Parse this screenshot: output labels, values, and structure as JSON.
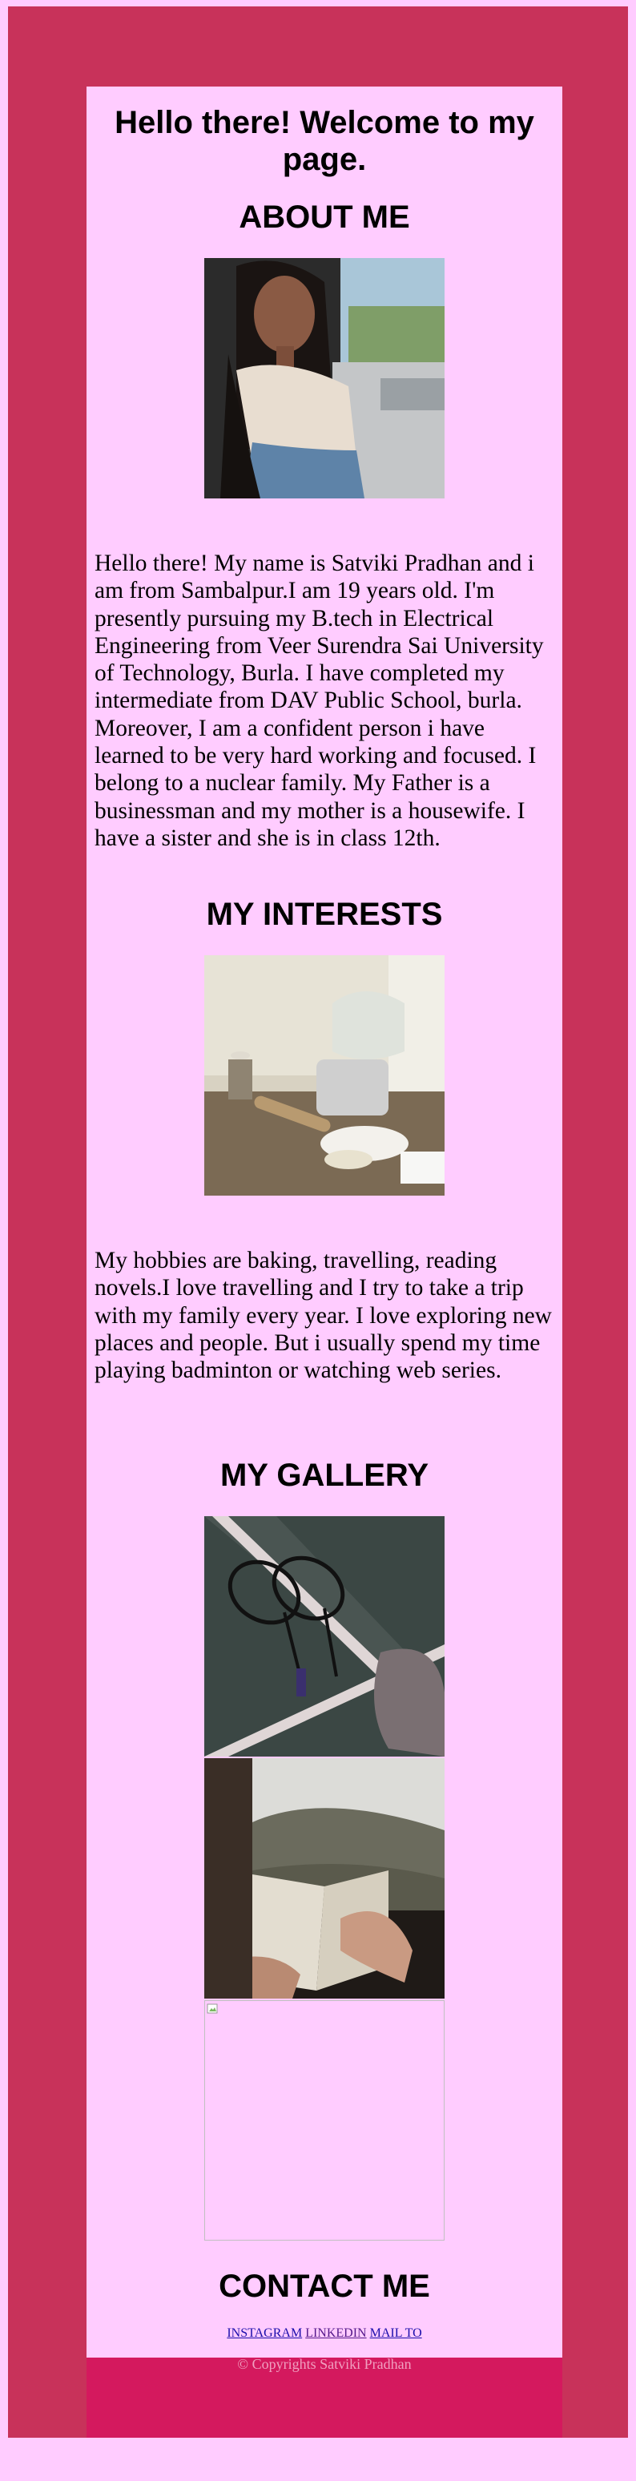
{
  "header": {
    "title": "Hello there! Welcome to my page."
  },
  "about": {
    "heading": "ABOUT ME",
    "text": "Hello there! My name is Satviki Pradhan and i am from Sambalpur.I am 19 years old. I'm presently pursuing my B.tech in Electrical Engineering from Veer Surendra Sai University of Technology, Burla. I have completed my intermediate from DAV Public School, burla. Moreover, I am a confident person i have learned to be very hard working and focused. I belong to a nuclear family. My Father is a businessman and my mother is a housewife. I have a sister and she is in class 12th."
  },
  "interests": {
    "heading": "MY INTERESTS",
    "text": "My hobbies are baking, travelling, reading novels.I love travelling and I try to take a trip with my family every year. I love exploring new places and people. But i usually spend my time playing badminton or watching web series."
  },
  "gallery": {
    "heading": "MY GALLERY"
  },
  "contact": {
    "heading": "CONTACT ME",
    "links": {
      "instagram": "INSTAGRAM",
      "linkedin": "LINKEDIN",
      "mail": "MAIL TO"
    }
  },
  "footer": {
    "copyright": "© Copyrights Satviki Pradhan"
  },
  "colors": {
    "page_background": "#ffccff",
    "frame": "#c8325a",
    "footer_band": "#d4195e",
    "footer_text": "#f0a0c0",
    "link": "#1a0dab"
  }
}
